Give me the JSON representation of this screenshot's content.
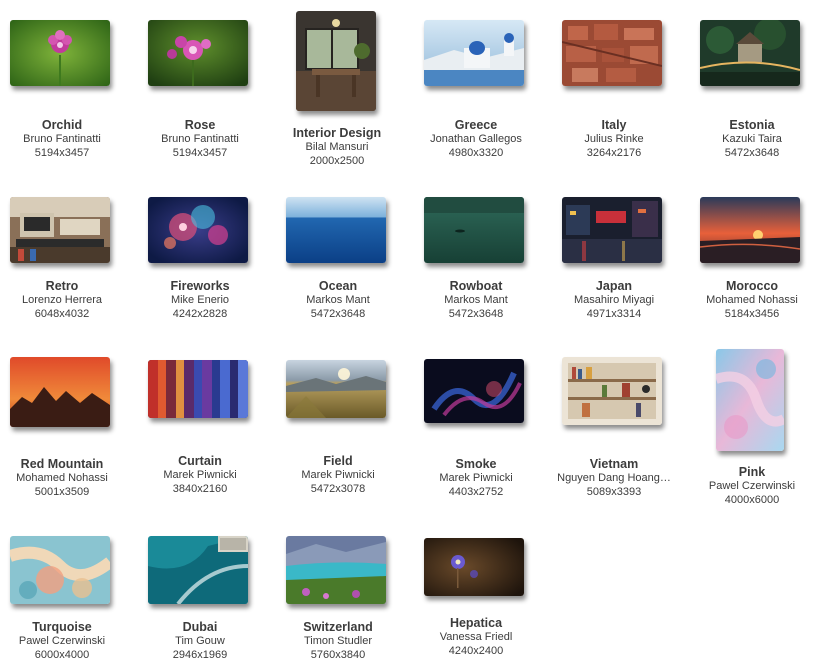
{
  "wallpapers": [
    {
      "title": "Orchid",
      "author": "Bruno Fantinatti",
      "resolution": "5194x3457"
    },
    {
      "title": "Rose",
      "author": "Bruno Fantinatti",
      "resolution": "5194x3457"
    },
    {
      "title": "Interior Design",
      "author": "Bilal Mansuri",
      "resolution": "2000x2500"
    },
    {
      "title": "Greece",
      "author": "Jonathan Gallegos",
      "resolution": "4980x3320"
    },
    {
      "title": "Italy",
      "author": "Julius Rinke",
      "resolution": "3264x2176"
    },
    {
      "title": "Estonia",
      "author": "Kazuki Taira",
      "resolution": "5472x3648"
    },
    {
      "title": "Retro",
      "author": "Lorenzo Herrera",
      "resolution": "6048x4032"
    },
    {
      "title": "Fireworks",
      "author": "Mike Enerio",
      "resolution": "4242x2828"
    },
    {
      "title": "Ocean",
      "author": "Markos Mant",
      "resolution": "5472x3648"
    },
    {
      "title": "Rowboat",
      "author": "Markos Mant",
      "resolution": "5472x3648"
    },
    {
      "title": "Japan",
      "author": "Masahiro Miyagi",
      "resolution": "4971x3314"
    },
    {
      "title": "Morocco",
      "author": "Mohamed Nohassi",
      "resolution": "5184x3456"
    },
    {
      "title": "Red Mountain",
      "author": "Mohamed Nohassi",
      "resolution": "5001x3509"
    },
    {
      "title": "Curtain",
      "author": "Marek Piwnicki",
      "resolution": "3840x2160"
    },
    {
      "title": "Field",
      "author": "Marek Piwnicki",
      "resolution": "5472x3078"
    },
    {
      "title": "Smoke",
      "author": "Marek Piwnicki",
      "resolution": "4403x2752"
    },
    {
      "title": "Vietnam",
      "author": "Nguyen Dang Hoang…",
      "resolution": "5089x3393"
    },
    {
      "title": "Pink",
      "author": "Pawel Czerwinski",
      "resolution": "4000x6000"
    },
    {
      "title": "Turquoise",
      "author": "Pawel Czerwinski",
      "resolution": "6000x4000"
    },
    {
      "title": "Dubai",
      "author": "Tim Gouw",
      "resolution": "2946x1969"
    },
    {
      "title": "Switzerland",
      "author": "Timon Studler",
      "resolution": "5760x3840"
    },
    {
      "title": "Hepatica",
      "author": "Vanessa Friedl",
      "resolution": "4240x2400"
    }
  ]
}
